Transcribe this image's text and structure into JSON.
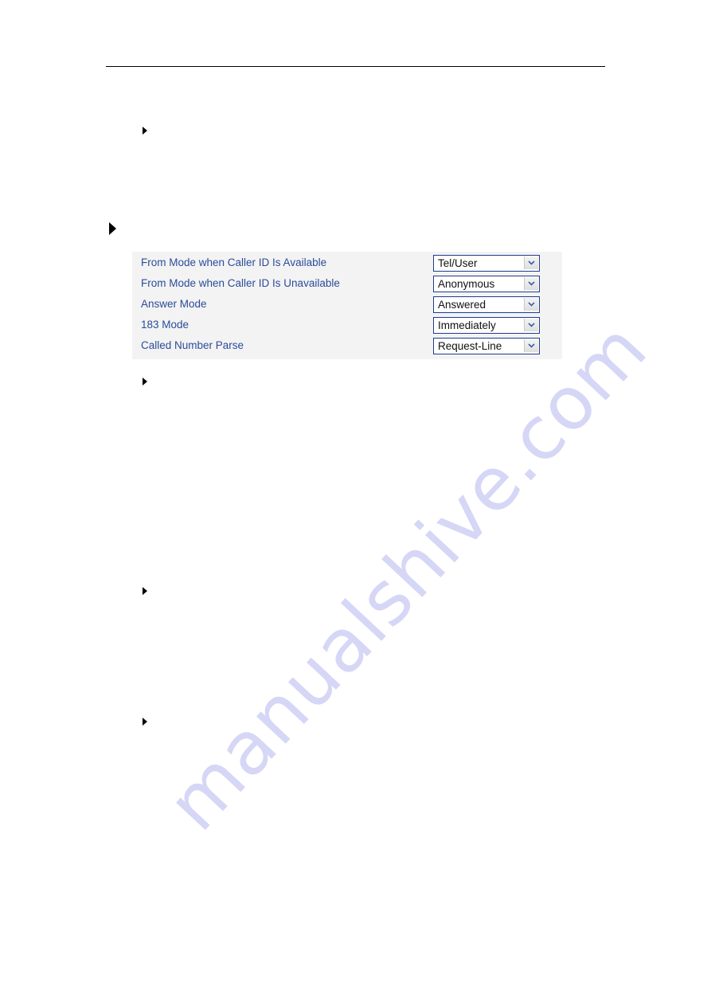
{
  "settings_panel": {
    "rows": [
      {
        "label": "From Mode when Caller ID Is Available",
        "value": "Tel/User"
      },
      {
        "label": "From Mode when Caller ID Is Unavailable",
        "value": "Anonymous"
      },
      {
        "label": "Answer Mode",
        "value": "Answered"
      },
      {
        "label": "183 Mode",
        "value": "Immediately"
      },
      {
        "label": "Called Number Parse",
        "value": "Request-Line"
      }
    ]
  },
  "bullets": [
    "bullet",
    "bullet-large",
    "bullet",
    "bullet",
    "bullet"
  ],
  "watermark": {
    "text": "manualshive.com"
  },
  "colors": {
    "label_text": "#2b4c9a",
    "select_border": "#1f3b8f",
    "panel_background": "#f3f3f3",
    "watermark": "#d6d6f6"
  }
}
